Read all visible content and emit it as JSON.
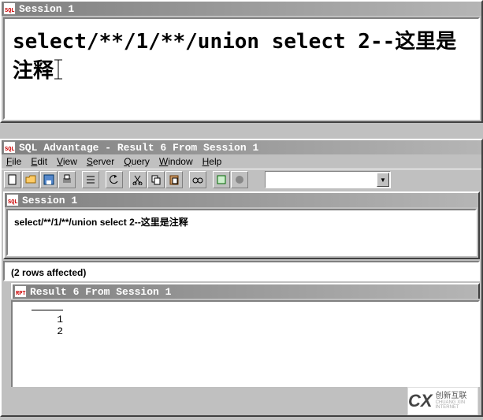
{
  "top_session": {
    "title": "Session 1",
    "icon": "SQL",
    "sql_text": "select/**/1/**/union select 2--这里是注释"
  },
  "app_window": {
    "title": "SQL Advantage - Result 6 From Session 1",
    "icon": "SQL",
    "menu": {
      "file": "File",
      "edit": "Edit",
      "view": "View",
      "server": "Server",
      "query": "Query",
      "window": "Window",
      "help": "Help"
    },
    "session_panel": {
      "title": "Session 1",
      "icon": "SQL",
      "sql_text": "select/**/1/**/union select 2--这里是注释"
    },
    "status_text": "(2 rows affected)",
    "result_panel": {
      "title": "Result 6 From Session 1",
      "icon": "RPT",
      "rows": [
        "1",
        "2"
      ]
    }
  },
  "watermark": {
    "logo": "CX",
    "text_cn": "创新互联",
    "text_en": "CHUANG XIN INTERNET"
  }
}
